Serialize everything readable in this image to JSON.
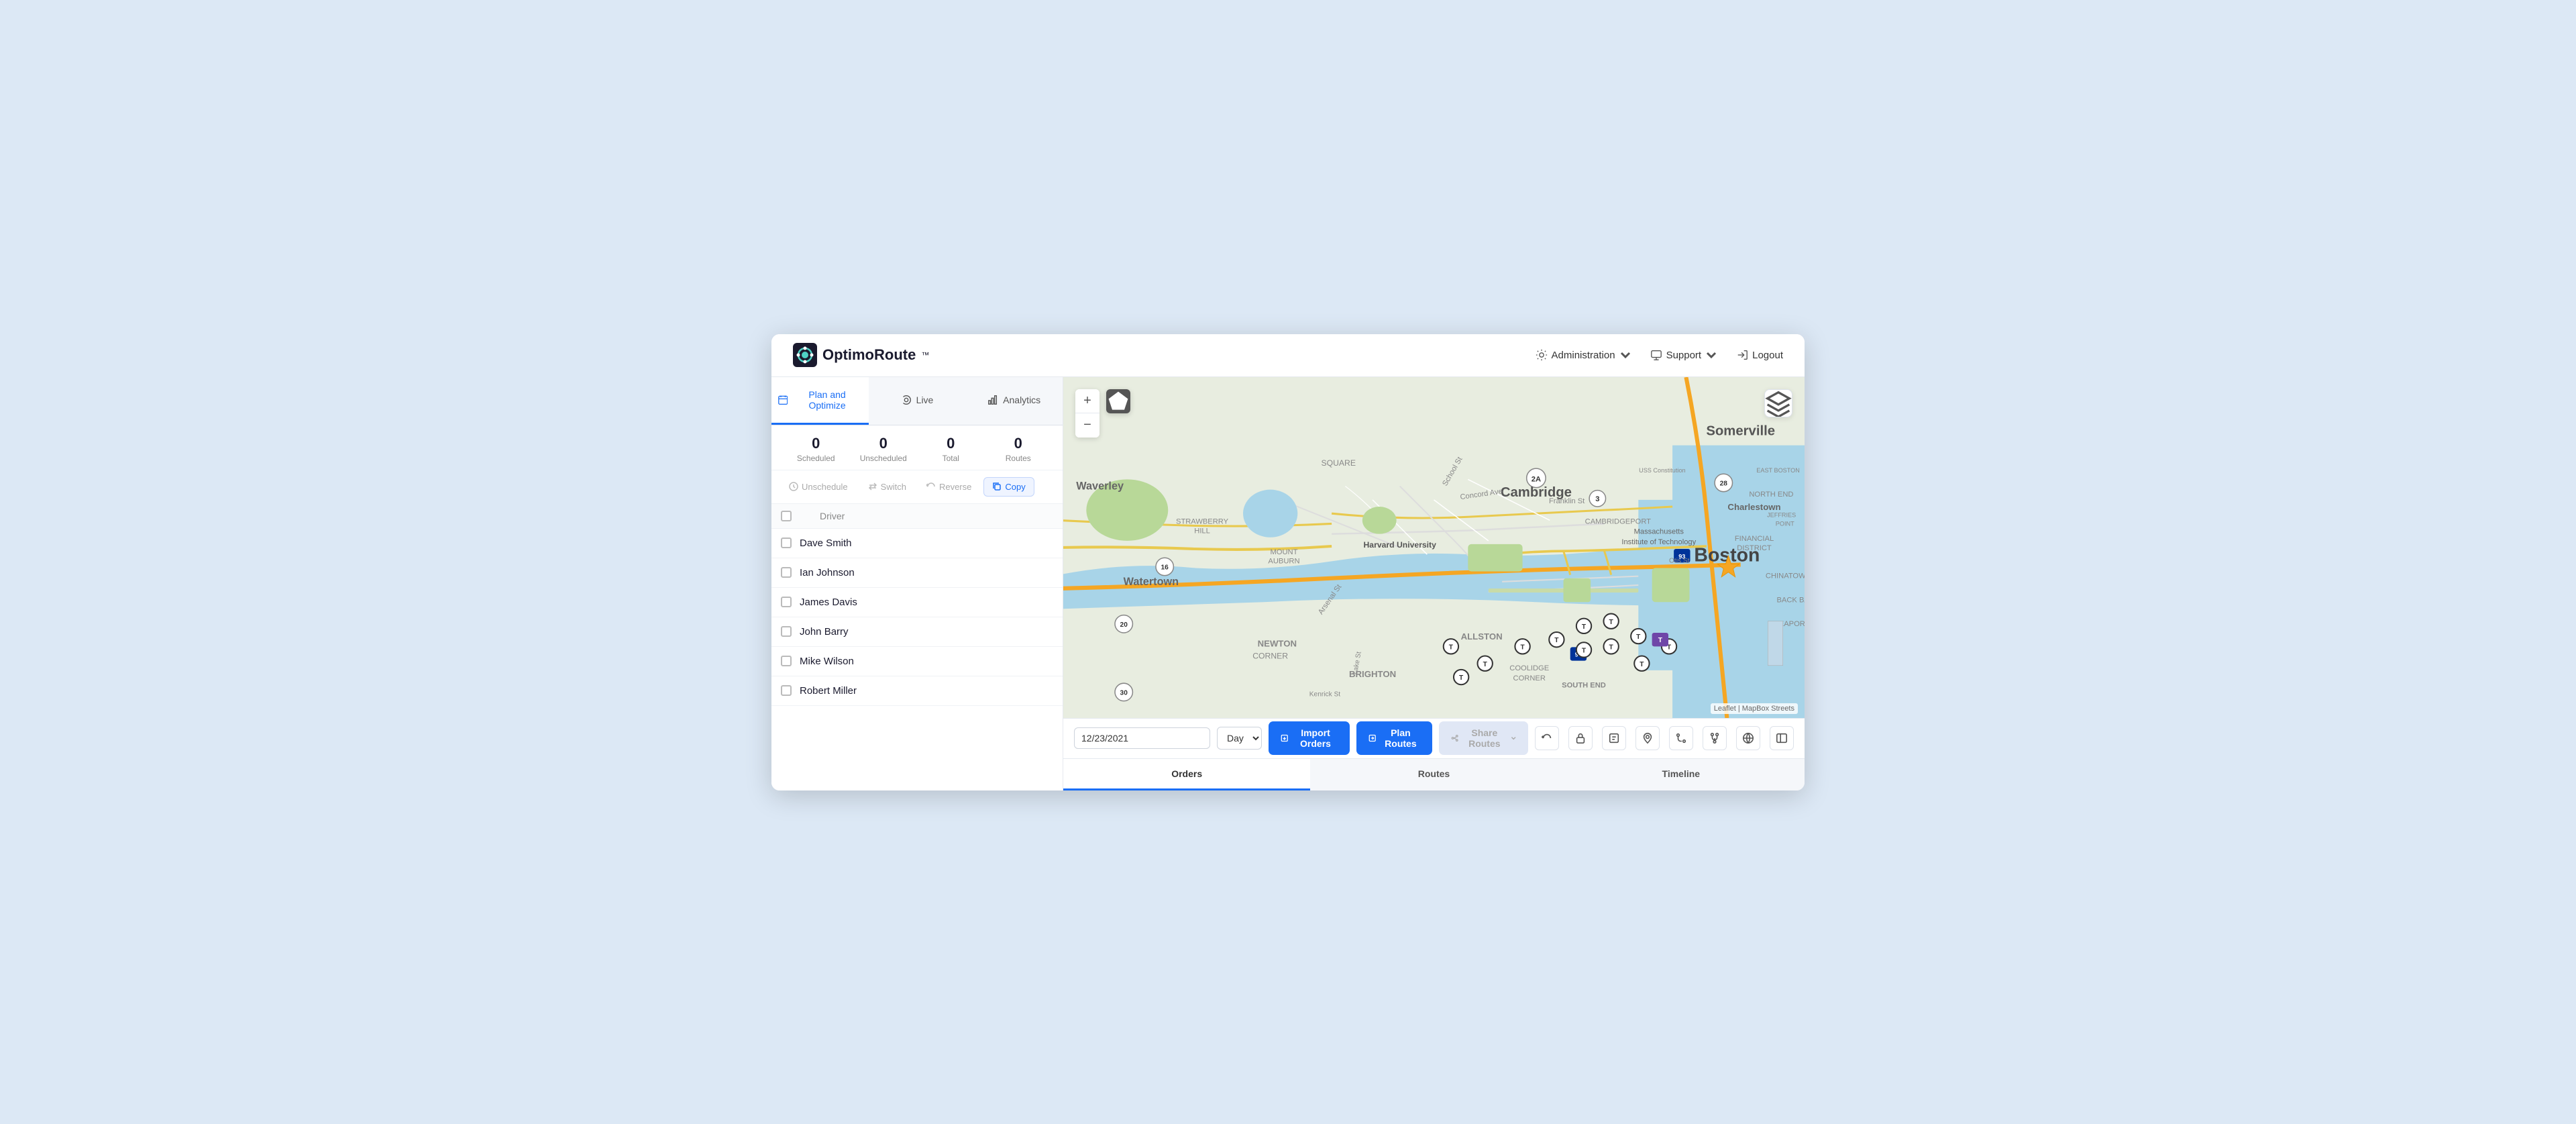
{
  "app": {
    "name": "OptimoRoute",
    "tm": "™"
  },
  "header": {
    "administration_label": "Administration",
    "support_label": "Support",
    "logout_label": "Logout"
  },
  "tabs": [
    {
      "id": "plan",
      "label": "Plan and Optimize",
      "active": true
    },
    {
      "id": "live",
      "label": "Live",
      "active": false
    },
    {
      "id": "analytics",
      "label": "Analytics",
      "active": false
    }
  ],
  "stats": {
    "scheduled": {
      "value": "0",
      "label": "Scheduled"
    },
    "unscheduled": {
      "value": "0",
      "label": "Unscheduled"
    },
    "total": {
      "value": "0",
      "label": "Total"
    },
    "routes": {
      "value": "0",
      "label": "Routes"
    }
  },
  "toolbar": {
    "unschedule": "Unschedule",
    "switch": "Switch",
    "reverse": "Reverse",
    "copy": "Copy"
  },
  "driver_list": {
    "header": "Driver",
    "drivers": [
      {
        "name": "Dave Smith"
      },
      {
        "name": "Ian Johnson"
      },
      {
        "name": "James Davis"
      },
      {
        "name": "John Barry"
      },
      {
        "name": "Mike Wilson"
      },
      {
        "name": "Robert Miller"
      }
    ]
  },
  "map": {
    "zoom_in": "+",
    "zoom_out": "−",
    "attribution": "Leaflet | MapBox Streets"
  },
  "bottom_bar": {
    "date": "12/23/2021",
    "day_option": "Day",
    "import_btn": "Import Orders",
    "plan_btn": "Plan Routes",
    "share_btn": "Share Routes"
  },
  "bottom_tabs": [
    {
      "label": "Orders",
      "active": true
    },
    {
      "label": "Routes",
      "active": false
    },
    {
      "label": "Timeline",
      "active": false
    }
  ],
  "map_labels": {
    "somerville": "Somerville",
    "cambridge": "Cambridge",
    "boston": "Boston",
    "waverley": "Waverley",
    "watertown": "Watertown",
    "charlestown": "Charlestown"
  }
}
